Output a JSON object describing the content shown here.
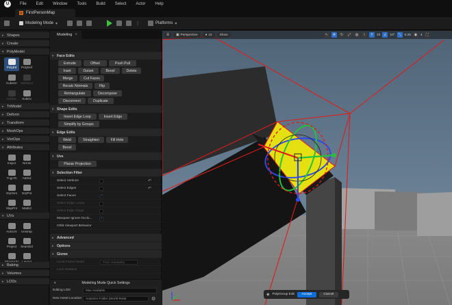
{
  "menu": [
    "File",
    "Edit",
    "Window",
    "Tools",
    "Build",
    "Select",
    "Actor",
    "Help"
  ],
  "map_tab": "FirstPersonMap",
  "toolbar": {
    "mode_label": "Modeling Mode",
    "platforms_label": "Platforms"
  },
  "palette": {
    "categories": [
      "Shapes",
      "Create",
      "PolyModel",
      "TriModel",
      "Deform",
      "Transform",
      "MeshOps",
      "VoxOps",
      "Attributes",
      "UVs",
      "Baking",
      "Volumes",
      "LODs"
    ],
    "polymodel_tools": [
      "PolyEd",
      "PolyDef",
      "CubeGr",
      "MshBool",
      "SubDiv",
      "SubDv"
    ],
    "attribute_tools": [
      "Inspct",
      "Nrmls",
      "TngnTs",
      "AttrEd",
      "GrpGen",
      "GrpPnt",
      "MapPnt",
      "MatEd"
    ],
    "uv_tools": [
      "AutoUV",
      "Unwrap",
      "Project",
      "SeamEd",
      "XFormUV",
      "Layout"
    ]
  },
  "panel": {
    "tab": "Modeling",
    "face_edits": {
      "title": "Face Edits",
      "buttons": [
        "Extrude",
        "Offset",
        "Push Pull",
        "Inset",
        "Outset",
        "Bevel",
        "Delete",
        "Merge",
        "Cut Faces",
        "Recalc Normals",
        "Flip",
        "Retriangulate",
        "Decompose",
        "Disconnect",
        "Duplicate"
      ]
    },
    "shape_edits": {
      "title": "Shape Edits",
      "buttons": [
        "Insert Edge Loop",
        "Insert Edge",
        "Simplify by Groups"
      ]
    },
    "edge_edits": {
      "title": "Edge Edits",
      "buttons": [
        "Weld",
        "Straighten",
        "Fill Hole",
        "Bevel"
      ]
    },
    "uvs": {
      "title": "Uvs",
      "buttons": [
        "Planar Projection"
      ]
    },
    "selection_filter": {
      "title": "Selection Filter",
      "rows": [
        "Select Vertices",
        "Select Edges",
        "Select Faces",
        "Select Edge Loops",
        "Select Edge Rings",
        "Marquee Ignore Occlu...",
        "Orbit Viewport Behavior"
      ]
    },
    "collapsed": [
      "Advanced",
      "Options",
      "Gizmo"
    ],
    "gizmo_rows": [
      {
        "label": "Local Frame Mode",
        "value": "From Geometry"
      },
      {
        "label": "Lock Rotation",
        "value": ""
      }
    ],
    "quick_settings": {
      "title": "Modeling Mode Quick Settings",
      "editing_lod_label": "Editing LOD",
      "editing_lod_value": "Max Available",
      "asset_location_label": "New Asset Location",
      "asset_location_value": "AutoGen Folder (World-Relat"
    }
  },
  "viewport": {
    "perspective": "Perspective",
    "lit": "Lit",
    "show": "Show",
    "angle": "10°",
    "scale": "0.25",
    "cam_speed": "4"
  },
  "accept_bar": {
    "label": "PolyGroup Edit",
    "accept": "Accept",
    "cancel": "Cancel"
  },
  "colors": {
    "accent": "#0e6ed7",
    "selection_yellow": "#e4e012",
    "selection_red": "#e01c1c"
  }
}
